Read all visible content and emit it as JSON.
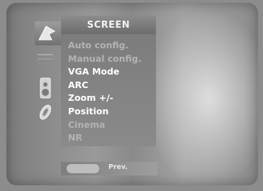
{
  "menu": {
    "title": "SCREEN",
    "items": [
      {
        "label": "Auto config.",
        "state": "dim"
      },
      {
        "label": "Manual config.",
        "state": "dim"
      },
      {
        "label": "VGA Mode",
        "state": "on"
      },
      {
        "label": "ARC",
        "state": "on"
      },
      {
        "label": "Zoom +/-",
        "state": "on"
      },
      {
        "label": "Position",
        "state": "on"
      },
      {
        "label": "Cinema",
        "state": "dim"
      },
      {
        "label": "NR",
        "state": "dim"
      }
    ]
  },
  "footer": {
    "prev_label": "Prev."
  },
  "side_icons": [
    "screen-icon",
    "input-icon",
    "sound-icon",
    "settings-icon"
  ]
}
